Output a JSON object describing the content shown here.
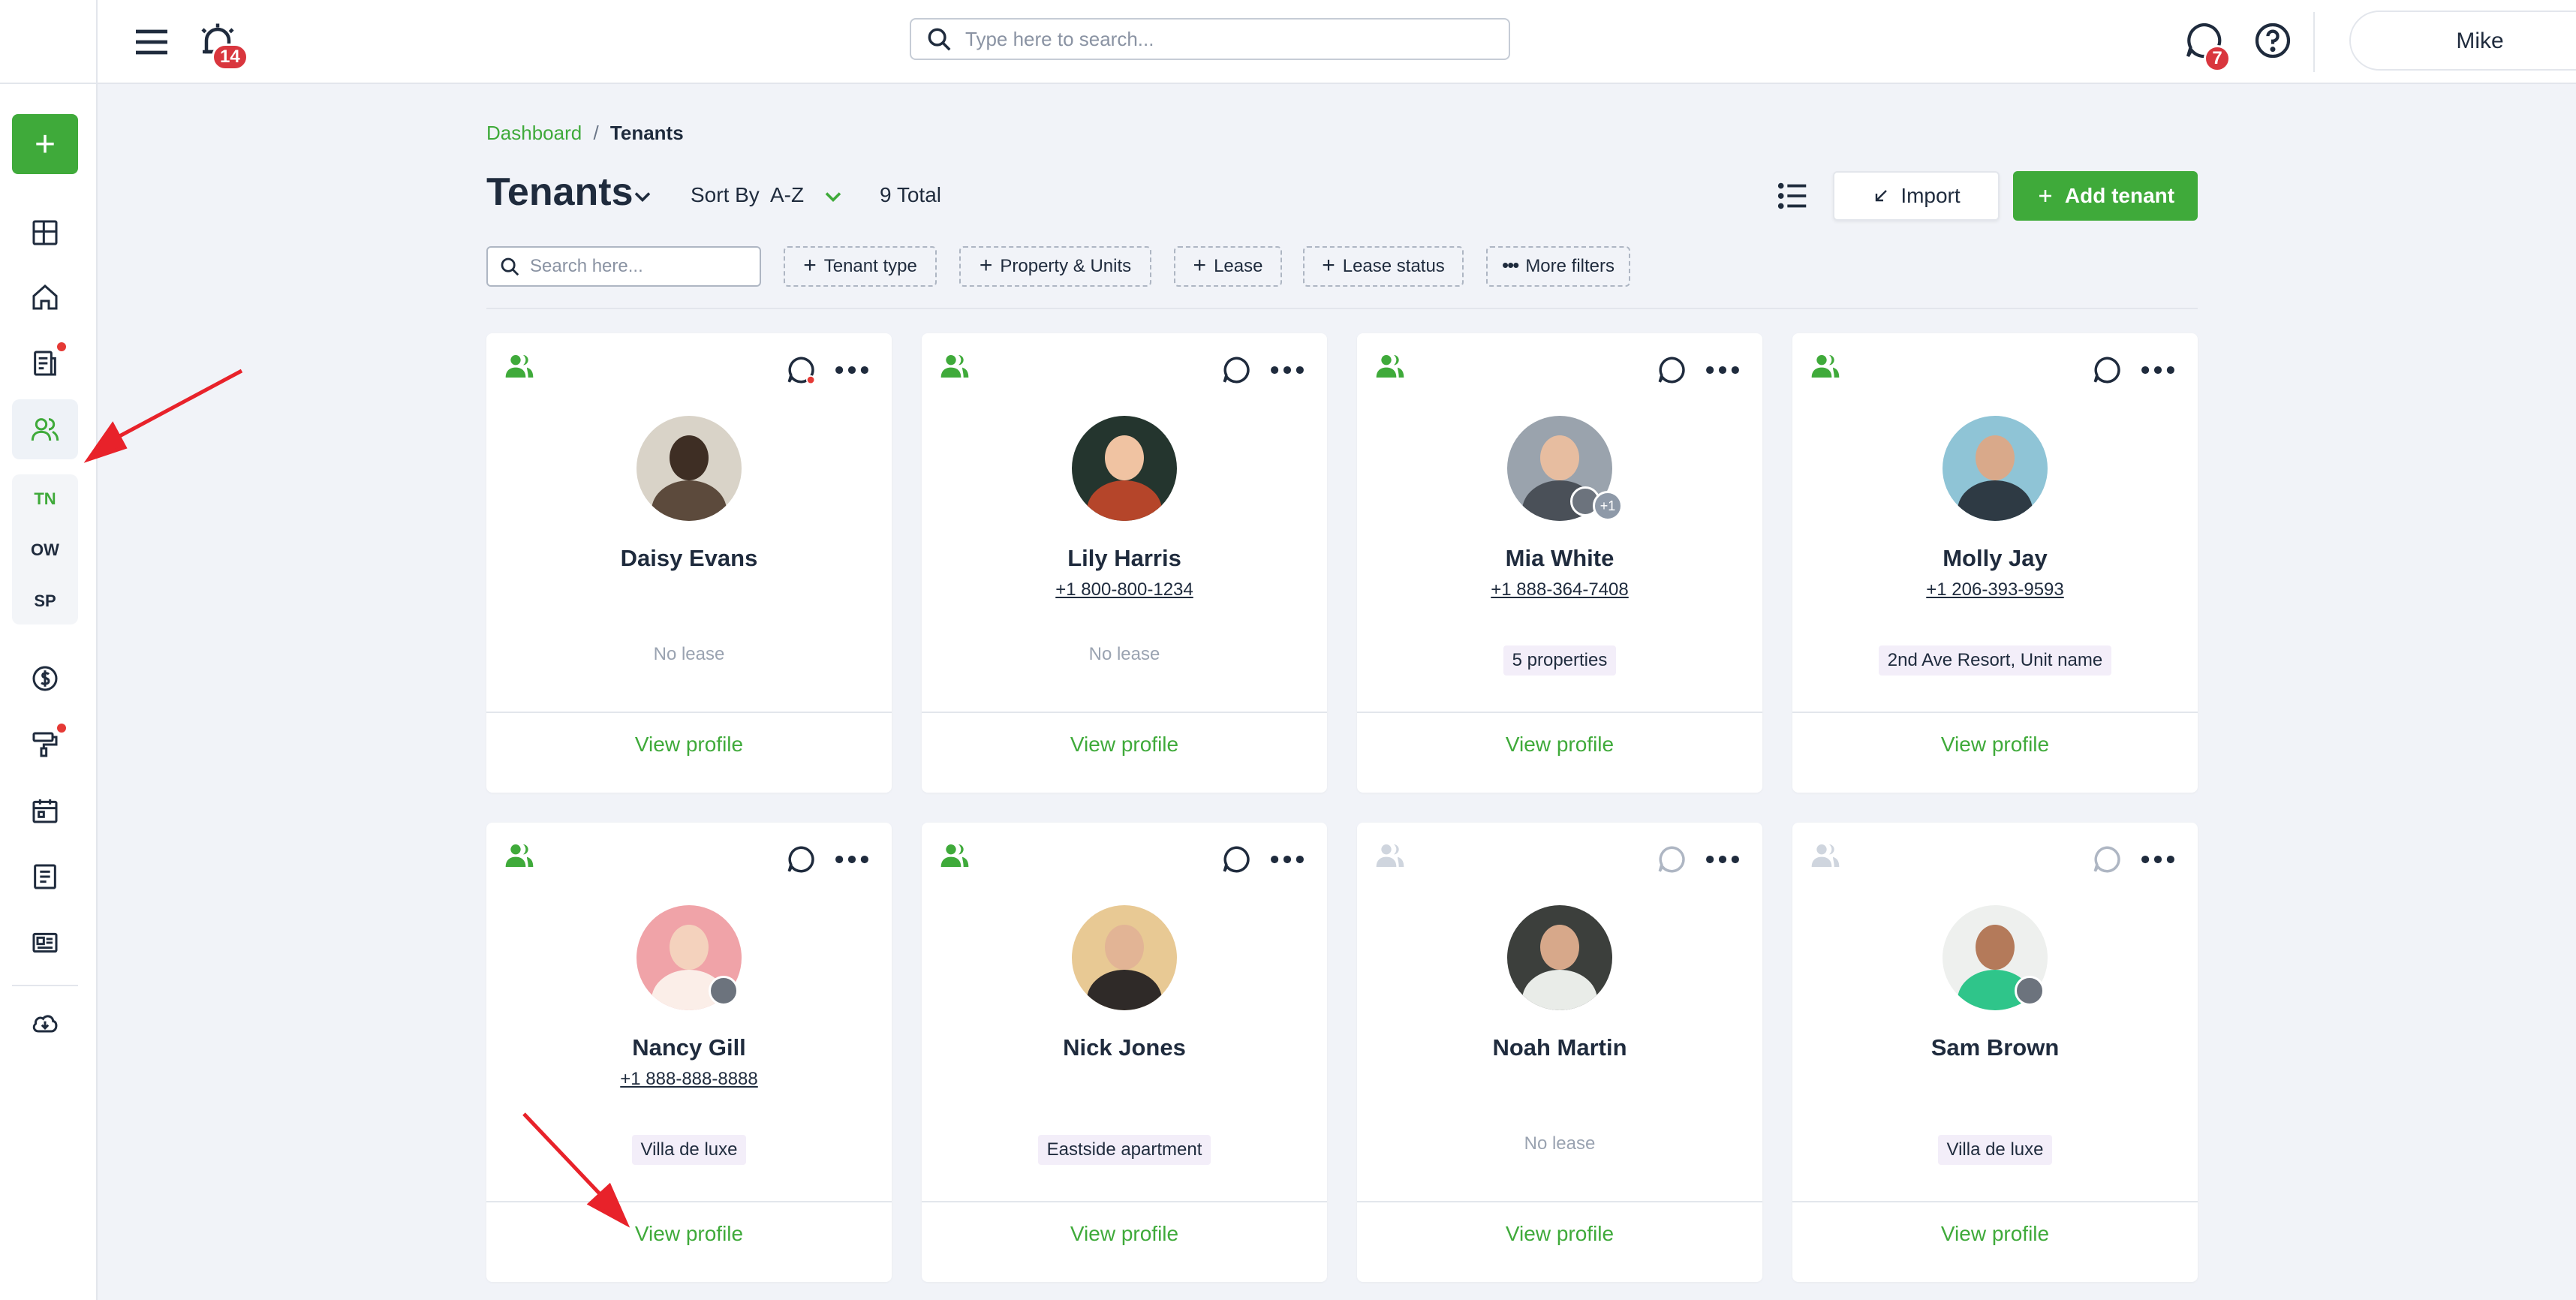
{
  "topbar": {
    "alarm_badge": "14",
    "search_placeholder": "Type here to search...",
    "chat_badge": "7",
    "user_name": "Mike"
  },
  "sidebar": {
    "add_label": "+",
    "sub_items": [
      "TN",
      "OW",
      "SP"
    ],
    "active_sub": "TN"
  },
  "breadcrumb": {
    "link": "Dashboard",
    "separator": "/",
    "current": "Tenants"
  },
  "header": {
    "title": "Tenants",
    "sort_label": "Sort By",
    "sort_value": "A-Z",
    "total": "9 Total",
    "import_label": "Import",
    "add_label": "Add tenant"
  },
  "filters": {
    "search_placeholder": "Search here...",
    "chips": [
      "Tenant type",
      "Property & Units",
      "Lease",
      "Lease status",
      "More filters"
    ]
  },
  "colors": {
    "accent": "#3faa3a",
    "badge": "#d9363e",
    "tag_bg": "#f3eef9",
    "inactive_icon": "#cfd5de"
  },
  "cards": [
    {
      "name": "Daisy Evans",
      "phone": "",
      "lease": "No lease",
      "tag": "",
      "view": "View profile",
      "active": true,
      "chat_unread": true
    },
    {
      "name": "Lily Harris",
      "phone": "+1 800-800-1234",
      "lease": "No lease",
      "tag": "",
      "view": "View profile",
      "active": true,
      "chat_unread": false
    },
    {
      "name": "Mia White",
      "phone": "+1 888-364-7408",
      "lease": "",
      "tag": "5 properties",
      "view": "View profile",
      "active": true,
      "chat_unread": false,
      "extra": "+1"
    },
    {
      "name": "Molly Jay",
      "phone": "+1 206-393-9593",
      "lease": "",
      "tag": "2nd Ave Resort, Unit name",
      "view": "View profile",
      "active": true,
      "chat_unread": false
    },
    {
      "name": "Nancy Gill",
      "phone": "+1 888-888-8888",
      "lease": "",
      "tag": "Villa de luxe",
      "view": "View profile",
      "active": true,
      "chat_unread": false
    },
    {
      "name": "Nick Jones",
      "phone": "",
      "lease": "",
      "tag": "Eastside apartment",
      "view": "View profile",
      "active": true,
      "chat_unread": false
    },
    {
      "name": "Noah Martin",
      "phone": "",
      "lease": "No lease",
      "tag": "",
      "view": "View profile",
      "active": false,
      "chat_unread": false
    },
    {
      "name": "Sam Brown",
      "phone": "",
      "lease": "",
      "tag": "Villa de luxe",
      "view": "View profile",
      "active": false,
      "chat_unread": false
    }
  ]
}
